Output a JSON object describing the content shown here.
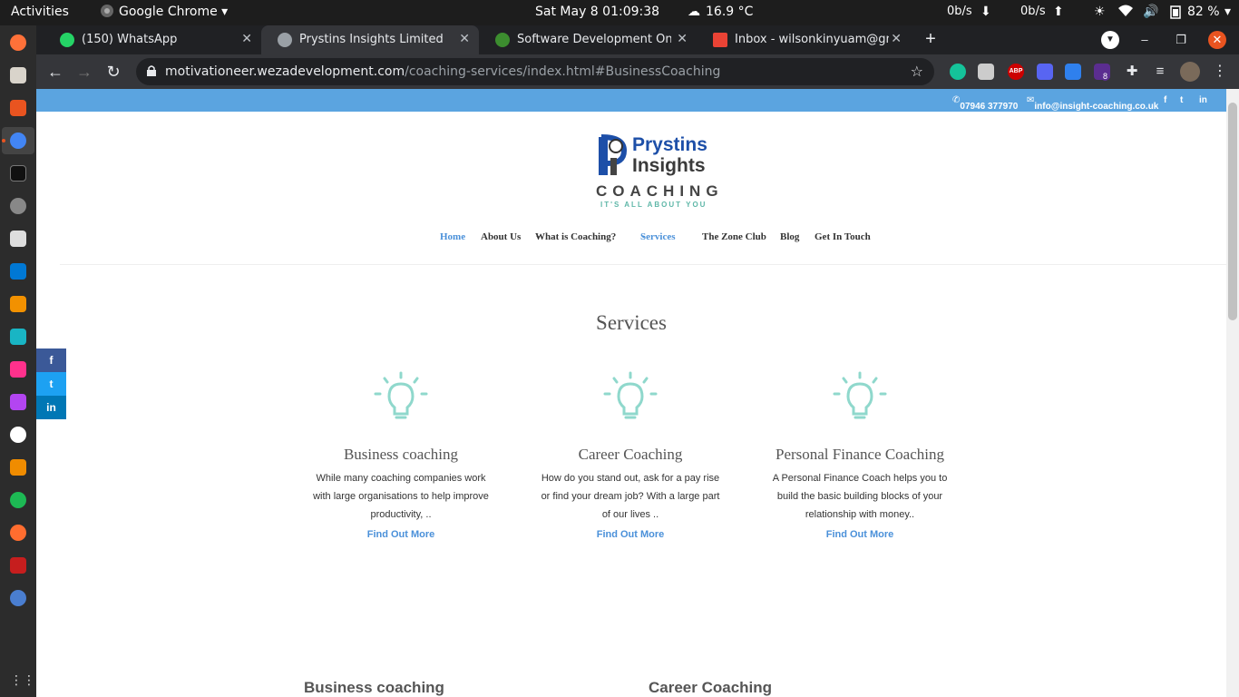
{
  "topbar": {
    "activities": "Activities",
    "app": "Google Chrome",
    "datetime": "Sat May 8  01:09:38",
    "weather": "16.9 °C",
    "net_down": "0b/s",
    "net_up": "0b/s",
    "battery": "82 %"
  },
  "tabs": [
    {
      "title": "(150) WhatsApp",
      "favicon_color": "#25d366"
    },
    {
      "title": "Prystins Insights Limited",
      "favicon_color": "#9aa0a6"
    },
    {
      "title": "Software Development Online |",
      "favicon_color": "#3c8d2f"
    },
    {
      "title": "Inbox - wilsonkinyuam@gmail.co",
      "favicon_color": "#ea4335"
    }
  ],
  "omnibox": {
    "domain": "motivationeer.wezadevelopment.com",
    "path": "/coaching-services/index.html#BusinessCoaching"
  },
  "extensions": {
    "badge": "8"
  },
  "site": {
    "phone": "07946 377970",
    "email": "info@insight-coaching.co.uk",
    "logo": {
      "line1": "Prystins",
      "line2": "Insights",
      "line3": "COACHING",
      "tagline": "IT'S ALL ABOUT YOU"
    },
    "nav": [
      "Home",
      "About Us",
      "What is Coaching?",
      "Services",
      "The Zone Club",
      "Blog",
      "Get In Touch"
    ],
    "section_title": "Services",
    "cards": [
      {
        "title": "Business coaching",
        "text": "While many coaching companies work with large organisations to help improve productivity, ..",
        "link": "Find Out More"
      },
      {
        "title": "Career Coaching",
        "text": "How do you stand out, ask for a pay rise or find your dream job? With a large part of our lives ..",
        "link": "Find Out More"
      },
      {
        "title": "Personal Finance Coaching",
        "text": "A Personal Finance Coach helps you to build the basic building blocks of your relationship with money..",
        "link": "Find Out More"
      }
    ],
    "social": [
      "f",
      "t",
      "in"
    ],
    "bottom_headings": [
      "Business coaching",
      "Career Coaching"
    ]
  },
  "colors": {
    "accent": "#4a90d9",
    "strip": "#5ba4e0",
    "bulb": "#8fd8cc"
  }
}
